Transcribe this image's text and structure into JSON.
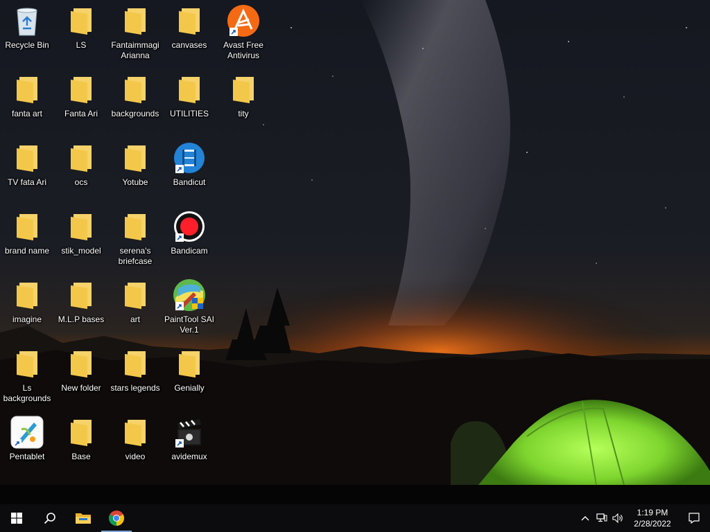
{
  "desktop_icons": [
    {
      "label": "Recycle Bin",
      "icon": "recycle-bin-icon"
    },
    {
      "label": "LS",
      "icon": "folder-icon"
    },
    {
      "label": "Fantaimmagi Arianna",
      "icon": "folder-icon"
    },
    {
      "label": "canvases",
      "icon": "folder-icon"
    },
    {
      "label": "Avast Free Antivirus",
      "icon": "avast-icon"
    },
    {
      "label": "fanta art",
      "icon": "folder-icon"
    },
    {
      "label": "Fanta Ari",
      "icon": "folder-icon"
    },
    {
      "label": "backgrounds",
      "icon": "folder-icon"
    },
    {
      "label": "UTILITIES",
      "icon": "folder-icon"
    },
    {
      "label": "tity",
      "icon": "folder-icon"
    },
    {
      "label": "TV  fata Ari",
      "icon": "folder-icon"
    },
    {
      "label": "ocs",
      "icon": "folder-icon"
    },
    {
      "label": "Yotube",
      "icon": "folder-icon"
    },
    {
      "label": "Bandicut",
      "icon": "bandicut-icon"
    },
    {
      "label": "brand name",
      "icon": "folder-icon"
    },
    {
      "label": "stik_model",
      "icon": "folder-icon"
    },
    {
      "label": "serena's briefcase",
      "icon": "folder-icon"
    },
    {
      "label": "Bandicam",
      "icon": "bandicam-icon"
    },
    {
      "label": "imagine",
      "icon": "folder-icon"
    },
    {
      "label": "M.L.P bases",
      "icon": "folder-icon"
    },
    {
      "label": "art",
      "icon": "folder-icon"
    },
    {
      "label": "PaintTool SAI Ver.1",
      "icon": "painttool-sai-icon"
    },
    {
      "label": "Ls backgrounds",
      "icon": "folder-icon"
    },
    {
      "label": "New folder",
      "icon": "folder-icon"
    },
    {
      "label": "stars legends",
      "icon": "folder-icon"
    },
    {
      "label": "Genially",
      "icon": "folder-icon"
    },
    {
      "label": "Pentablet",
      "icon": "pentablet-icon"
    },
    {
      "label": "Base",
      "icon": "folder-icon"
    },
    {
      "label": "video",
      "icon": "folder-icon"
    },
    {
      "label": "avidemux",
      "icon": "avidemux-icon"
    }
  ],
  "taskbar": {
    "apps": [
      {
        "name": "start-button",
        "icon": "windows-logo-icon"
      },
      {
        "name": "search-button",
        "icon": "search-icon"
      },
      {
        "name": "file-explorer-button",
        "icon": "file-explorer-icon"
      },
      {
        "name": "chrome-button",
        "icon": "chrome-icon"
      }
    ],
    "tray": {
      "time": "1:19 PM",
      "date": "2/28/2022",
      "icons": [
        "chevron-up-icon",
        "network-icon",
        "volume-icon"
      ]
    }
  },
  "colors": {
    "taskbar_bg": "#0c0c0e",
    "folder_yellow": "#f3c84a",
    "tent_green": "#8fe03a",
    "sunset_orange": "#ff7a1a"
  }
}
